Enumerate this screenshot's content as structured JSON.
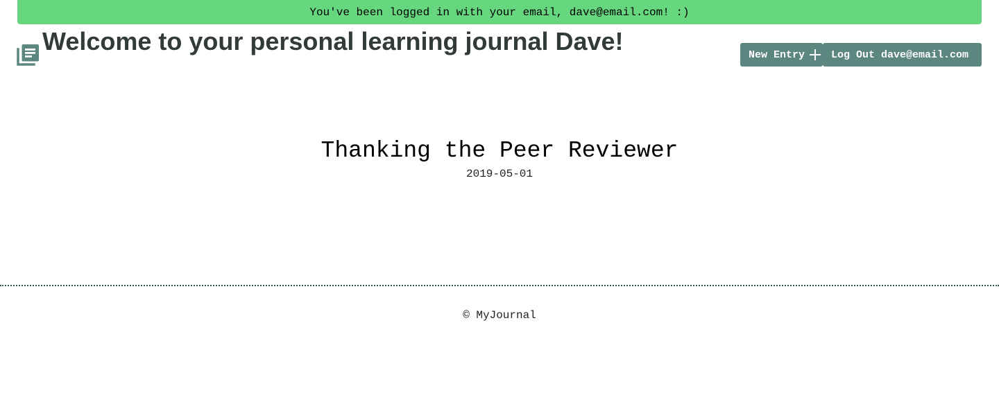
{
  "flash": {
    "message": "You've been logged in with your email, dave@email.com! :)",
    "color": "#67d77f"
  },
  "header": {
    "logo_icon": "journal-stack-icon",
    "title": "Welcome to your personal learning journal Dave!",
    "new_entry_label": "New Entry",
    "new_entry_icon": "plus-icon",
    "logout_label": "Log Out dave@email.com",
    "button_color": "#5c8680"
  },
  "entry": {
    "title": "Thanking the Peer Reviewer",
    "date": "2019-05-01"
  },
  "footer": {
    "text": "© MyJournal"
  }
}
